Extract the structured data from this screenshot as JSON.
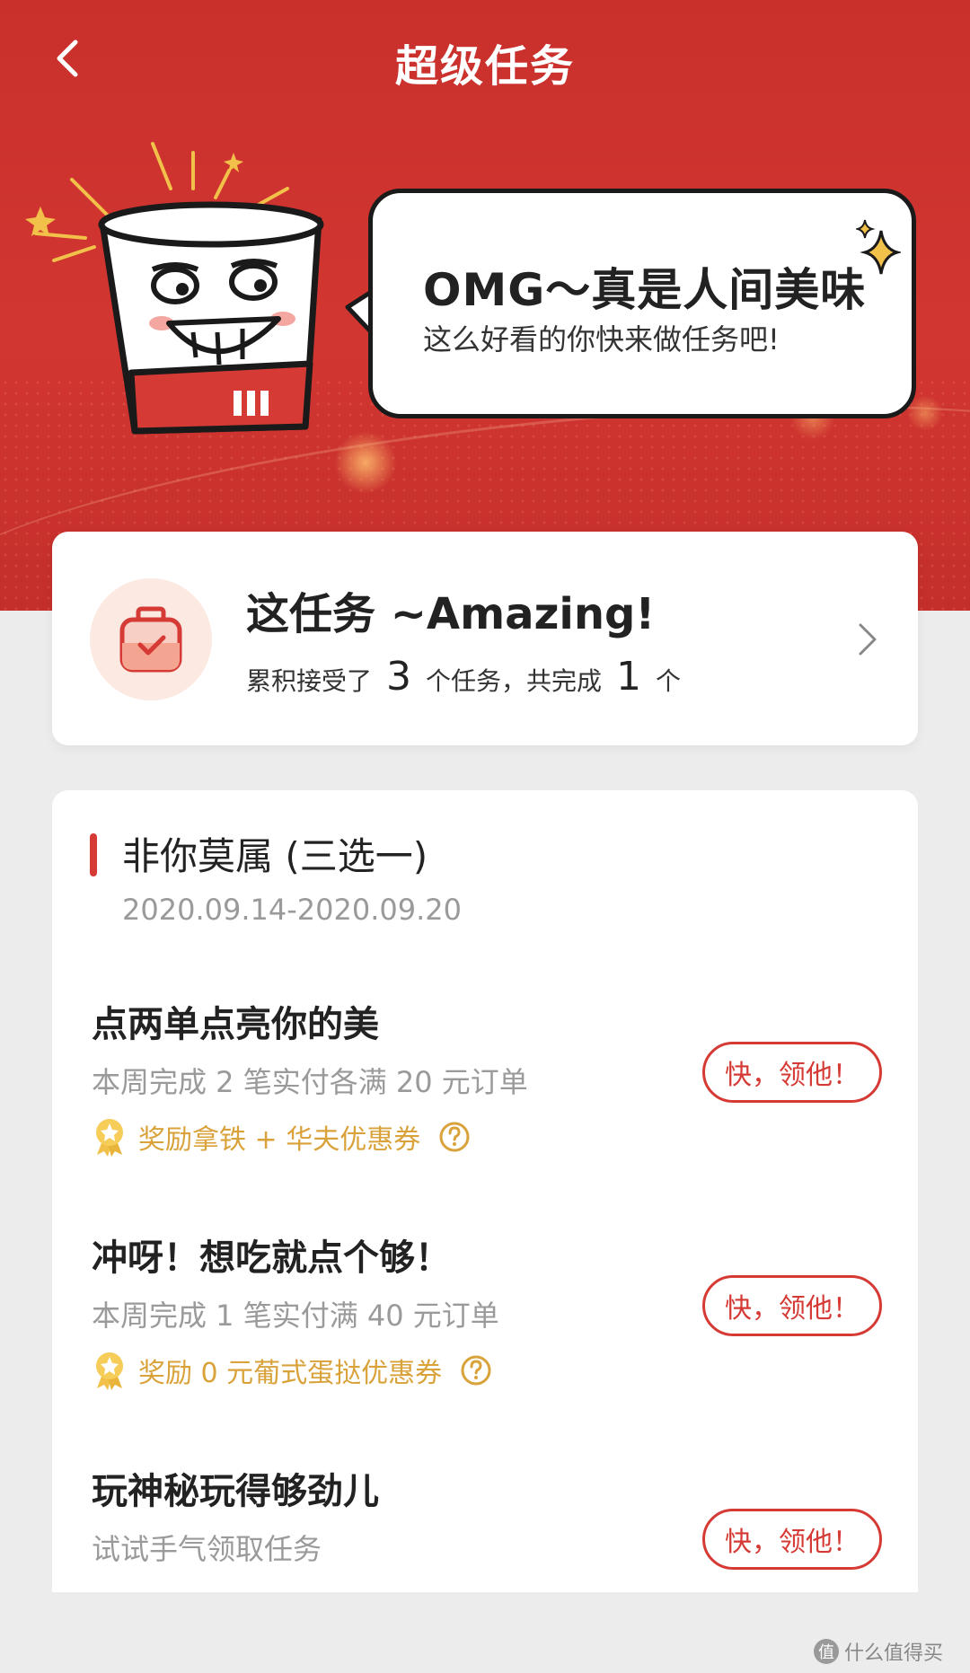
{
  "header": {
    "title": "超级任务"
  },
  "bubble": {
    "title": "OMG～真是人间美味",
    "subtitle": "这么好看的你快来做任务吧!"
  },
  "summary": {
    "title": "这任务 ~Amazing!",
    "prefix": "累积接受了",
    "accepted": "3",
    "middle": "个任务，共完成",
    "completed": "1",
    "suffix": "个"
  },
  "section": {
    "title": "非你莫属 (三选一)",
    "date_range": "2020.09.14-2020.09.20"
  },
  "tasks": [
    {
      "title": "点两单点亮你的美",
      "desc": "本周完成 2 笔实付各满 20 元订单",
      "reward": "奖励拿铁 + 华夫优惠券",
      "button": "快，领他！"
    },
    {
      "title": "冲呀！想吃就点个够！",
      "desc": "本周完成 1 笔实付满 40 元订单",
      "reward": "奖励 0 元葡式蛋挞优惠券",
      "button": "快，领他！"
    },
    {
      "title": "玩神秘玩得够劲儿",
      "desc": "试试手气领取任务",
      "button": "快，领他！"
    }
  ],
  "watermark": {
    "text": "什么值得买",
    "logo_text": "值"
  },
  "colors": {
    "accent": "#d53a35",
    "header_bg": "#c9302c",
    "reward": "#d9a23a",
    "muted": "#9a9a9a"
  }
}
